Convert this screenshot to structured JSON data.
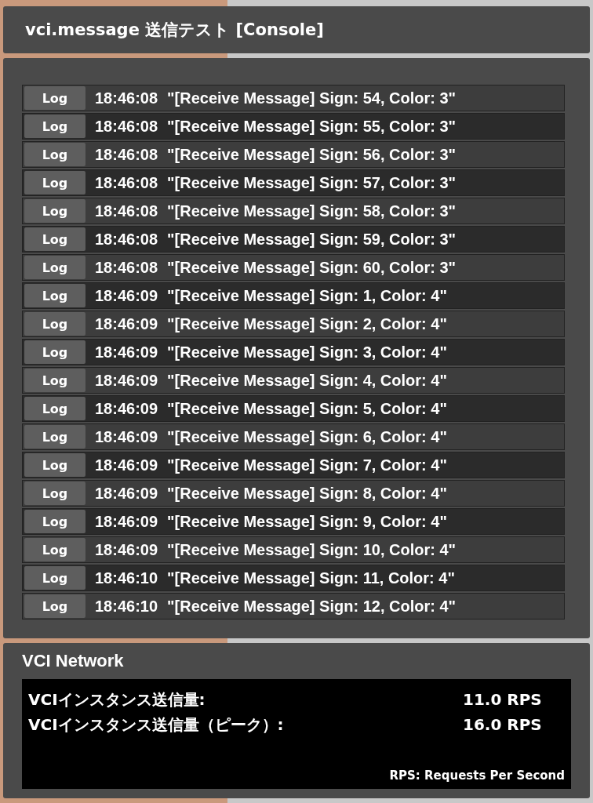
{
  "window": {
    "title": "vci.message 送信テスト [Console]"
  },
  "console": {
    "rows": [
      {
        "button": "Log",
        "time": "18:46:08",
        "message": "\"[Receive Message] Sign: 54, Color: 3\""
      },
      {
        "button": "Log",
        "time": "18:46:08",
        "message": "\"[Receive Message] Sign: 55, Color: 3\""
      },
      {
        "button": "Log",
        "time": "18:46:08",
        "message": "\"[Receive Message] Sign: 56, Color: 3\""
      },
      {
        "button": "Log",
        "time": "18:46:08",
        "message": "\"[Receive Message] Sign: 57, Color: 3\""
      },
      {
        "button": "Log",
        "time": "18:46:08",
        "message": "\"[Receive Message] Sign: 58, Color: 3\""
      },
      {
        "button": "Log",
        "time": "18:46:08",
        "message": "\"[Receive Message] Sign: 59, Color: 3\""
      },
      {
        "button": "Log",
        "time": "18:46:08",
        "message": "\"[Receive Message] Sign: 60, Color: 3\""
      },
      {
        "button": "Log",
        "time": "18:46:09",
        "message": "\"[Receive Message] Sign: 1, Color: 4\""
      },
      {
        "button": "Log",
        "time": "18:46:09",
        "message": "\"[Receive Message] Sign: 2, Color: 4\""
      },
      {
        "button": "Log",
        "time": "18:46:09",
        "message": "\"[Receive Message] Sign: 3, Color: 4\""
      },
      {
        "button": "Log",
        "time": "18:46:09",
        "message": "\"[Receive Message] Sign: 4, Color: 4\""
      },
      {
        "button": "Log",
        "time": "18:46:09",
        "message": "\"[Receive Message] Sign: 5, Color: 4\""
      },
      {
        "button": "Log",
        "time": "18:46:09",
        "message": "\"[Receive Message] Sign: 6, Color: 4\""
      },
      {
        "button": "Log",
        "time": "18:46:09",
        "message": "\"[Receive Message] Sign: 7, Color: 4\""
      },
      {
        "button": "Log",
        "time": "18:46:09",
        "message": "\"[Receive Message] Sign: 8, Color: 4\""
      },
      {
        "button": "Log",
        "time": "18:46:09",
        "message": "\"[Receive Message] Sign: 9, Color: 4\""
      },
      {
        "button": "Log",
        "time": "18:46:09",
        "message": "\"[Receive Message] Sign: 10, Color: 4\""
      },
      {
        "button": "Log",
        "time": "18:46:10",
        "message": "\"[Receive Message] Sign: 11, Color: 4\""
      },
      {
        "button": "Log",
        "time": "18:46:10",
        "message": "\"[Receive Message] Sign: 12, Color: 4\""
      }
    ]
  },
  "network": {
    "title": "VCI Network",
    "stats": [
      {
        "label": "VCIインスタンス送信量:",
        "value": "11.0 RPS"
      },
      {
        "label": "VCIインスタンス送信量（ピーク）:",
        "value": "16.0 RPS"
      }
    ],
    "footnote": "RPS: Requests Per Second"
  }
}
